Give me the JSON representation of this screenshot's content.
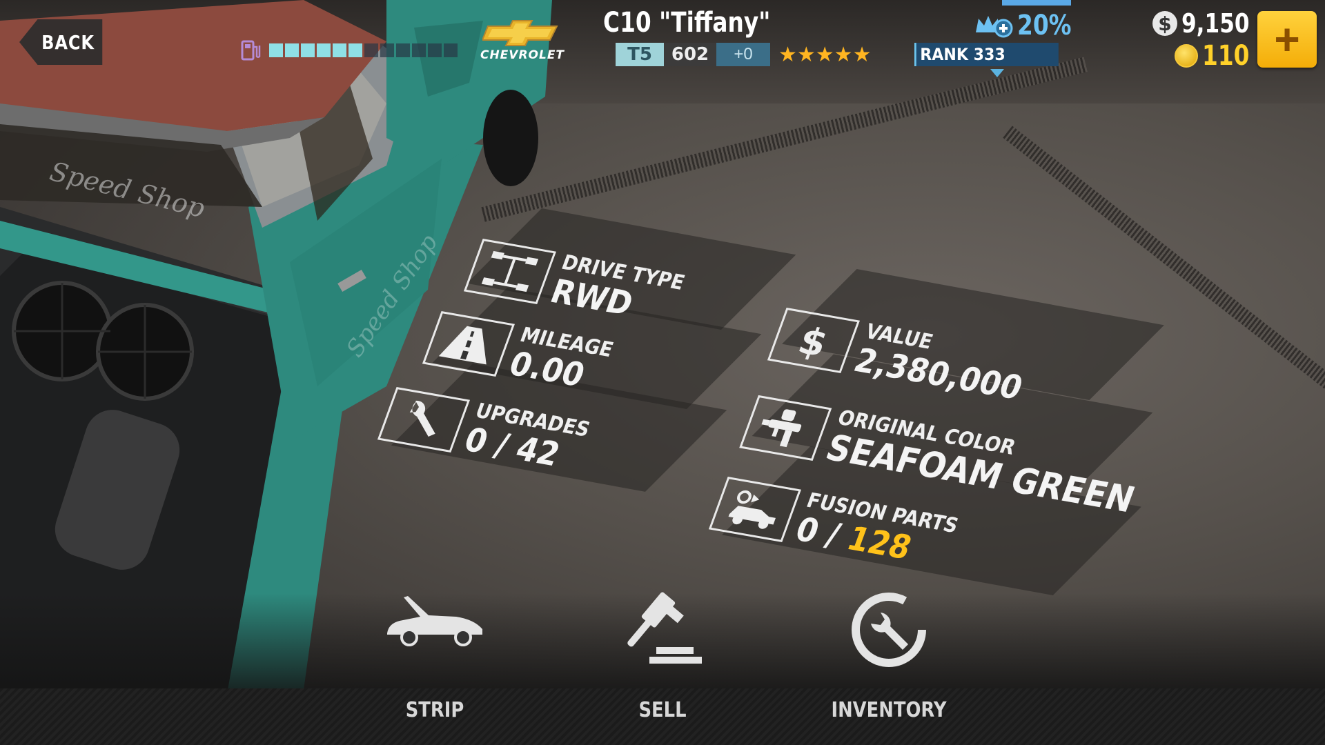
{
  "header": {
    "back_label": "BACK",
    "brand_name": "CHEVROLET",
    "car_title": "C10 \"Tiffany\"",
    "tier": "T5",
    "pp": "602",
    "pp_bonus": "+0",
    "stars": 5,
    "stars_text": "★★★★★",
    "rank_label": "RANK 333",
    "boost_percent": "20%",
    "cash": "9,150",
    "gold": "110",
    "add_currency_label": "+",
    "fuel": {
      "filled": 6,
      "total": 12
    }
  },
  "car_info": {
    "drive_type": {
      "label": "DRIVE TYPE",
      "value": "RWD"
    },
    "mileage": {
      "label": "MILEAGE",
      "value": "0.00"
    },
    "upgrades": {
      "label": "UPGRADES",
      "value": "0 / 42"
    },
    "value": {
      "label": "VALUE",
      "value": "2,380,000"
    },
    "original_color": {
      "label": "ORIGINAL COLOR",
      "value": "SEAFOAM GREEN"
    },
    "fusion_parts": {
      "label": "FUSION PARTS",
      "current": "0 / ",
      "total": "128"
    }
  },
  "actions": [
    {
      "label": "STRIP",
      "icon": "car-hood-open-icon"
    },
    {
      "label": "SELL",
      "icon": "gavel-icon"
    },
    {
      "label": "INVENTORY",
      "icon": "wrench-circle-icon"
    }
  ],
  "colors": {
    "accent_gold": "#ffc21a",
    "boost_blue": "#6dc1f2",
    "fuel_cyan": "#8fe0e6",
    "rank_blue": "#1f4a6e",
    "truck_teal": "#2e8a7e"
  }
}
